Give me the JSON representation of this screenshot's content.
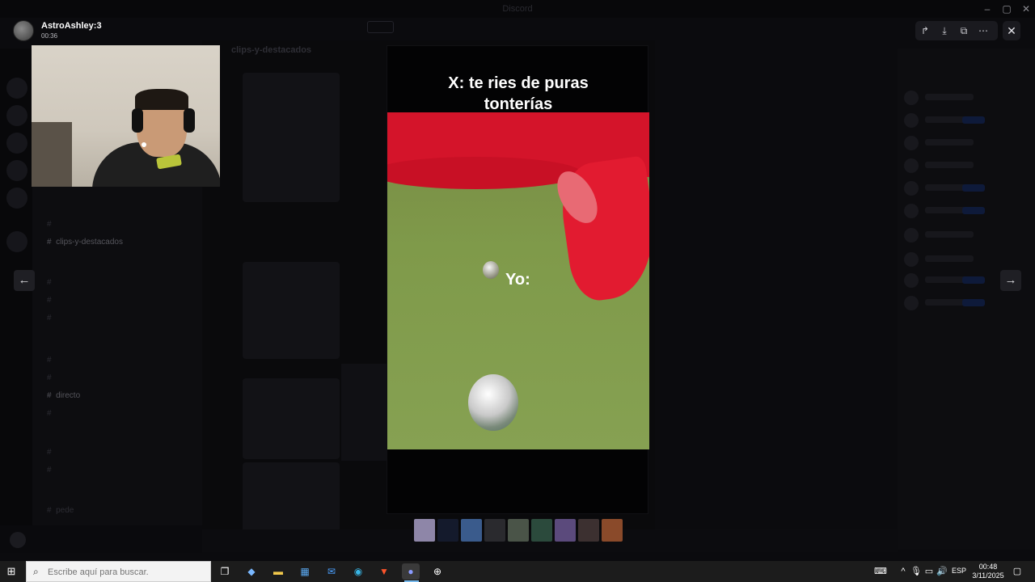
{
  "app": {
    "window_title": "Discord"
  },
  "viewer": {
    "uploader_name": "AstroAshley:3",
    "uploader_time": "00:36",
    "caption_line1": "X: te ries de puras",
    "caption_line2": "tonterías",
    "overlay_text": "Yo:",
    "actions": {
      "forward_icon": "forward-icon",
      "download_icon": "download-icon",
      "open_external_icon": "open-external-icon",
      "more_icon": "more-icon",
      "close_icon": "close-icon"
    },
    "thumbnail_count": 9
  },
  "background": {
    "channel_header": "clips-y-destacados",
    "channels": [
      "clips-y-destacados",
      "directo",
      "pede"
    ]
  },
  "taskbar": {
    "search_placeholder": "Escribe aquí para buscar.",
    "language": "ESP",
    "time": "00:48",
    "date": "3/11/2025"
  },
  "colors": {
    "accent_red": "#d4142a",
    "field_green": "#7f9a4a",
    "taskbar": "#1c1c1c"
  }
}
